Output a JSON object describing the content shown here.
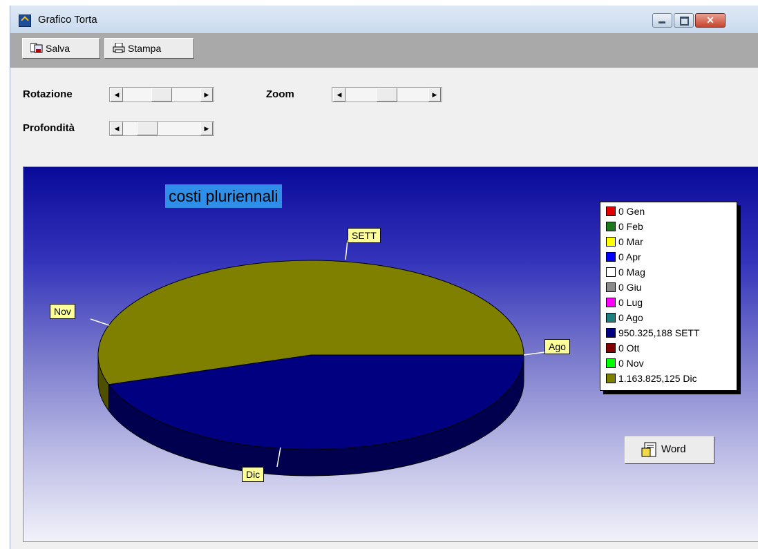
{
  "window": {
    "title": "Grafico Torta"
  },
  "toolbar": {
    "save_label": "Salva",
    "print_label": "Stampa"
  },
  "controls": {
    "rotation": {
      "label": "Rotazione",
      "position": 0.5
    },
    "zoom": {
      "label": "Zoom",
      "position": 0.5
    },
    "depth": {
      "label": "Profondità",
      "position": 0.25
    }
  },
  "chart": {
    "word_button": "Word"
  },
  "chart_data": {
    "type": "pie",
    "title": "costi pluriennali",
    "categories": [
      "Gen",
      "Feb",
      "Mar",
      "Apr",
      "Mag",
      "Giu",
      "Lug",
      "Ago",
      "SETT",
      "Ott",
      "Nov",
      "Dic"
    ],
    "values": [
      0,
      0,
      0,
      0,
      0,
      0,
      0,
      0,
      950325.188,
      0,
      0,
      1163825.125
    ],
    "legend": [
      {
        "label": "0 Gen",
        "color": "#e00000"
      },
      {
        "label": "0 Feb",
        "color": "#1a7a1a"
      },
      {
        "label": "0 Mar",
        "color": "#ffff00"
      },
      {
        "label": "0 Apr",
        "color": "#0000ff"
      },
      {
        "label": "0 Mag",
        "color": "#ffffff"
      },
      {
        "label": "0 Giu",
        "color": "#8a8a8a"
      },
      {
        "label": "0 Lug",
        "color": "#ff00ff"
      },
      {
        "label": "0 Ago",
        "color": "#1a8080"
      },
      {
        "label": "950.325,188 SETT",
        "color": "#000080"
      },
      {
        "label": "0 Ott",
        "color": "#800000"
      },
      {
        "label": "0 Nov",
        "color": "#00ff00"
      },
      {
        "label": "1.163.825,125 Dic",
        "color": "#808000"
      }
    ],
    "slice_labels": [
      "SETT",
      "Nov",
      "Ago",
      "Dic"
    ],
    "legend_placement": "right"
  }
}
